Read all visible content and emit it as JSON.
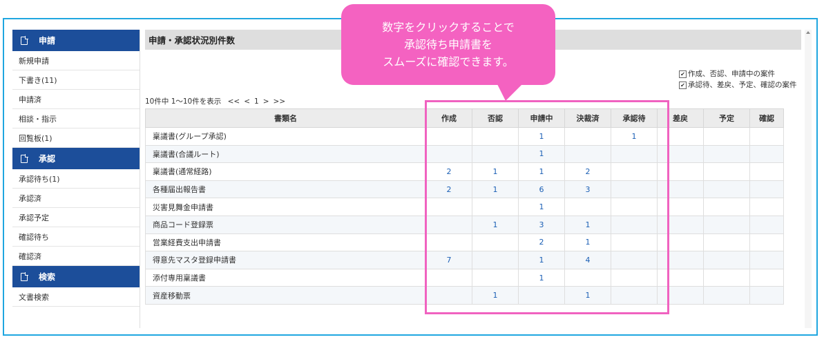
{
  "sidebar": {
    "sections": [
      {
        "title": "申請",
        "items": [
          "新規申請",
          "下書き(11)",
          "申請済",
          "相談・指示",
          "回覧板(1)"
        ]
      },
      {
        "title": "承認",
        "items": [
          "承認待ち(1)",
          "承認済",
          "承認予定",
          "確認待ち",
          "確認済"
        ]
      },
      {
        "title": "検索",
        "items": [
          "文書検索"
        ]
      }
    ]
  },
  "main": {
    "title": "申請・承認状況別件数",
    "filters": [
      "作成、否認、申請中の案件",
      "承認待、差戻、予定、確認の案件"
    ],
    "pager": {
      "summary": "10件中 1～10件を表示",
      "first": "<<",
      "prev": "<",
      "page": "1",
      "next": ">",
      "last": ">>"
    },
    "columns": [
      "書類名",
      "作成",
      "否認",
      "申請中",
      "決裁済",
      "承認待",
      "差戻",
      "予定",
      "確認"
    ],
    "rows": [
      [
        "稟議書(グループ承認)",
        "",
        "",
        "1",
        "",
        "1",
        "",
        "",
        ""
      ],
      [
        "稟議書(合議ルート)",
        "",
        "",
        "1",
        "",
        "",
        "",
        "",
        ""
      ],
      [
        "稟議書(通常経路)",
        "2",
        "1",
        "1",
        "2",
        "",
        "",
        "",
        ""
      ],
      [
        "各種届出報告書",
        "2",
        "1",
        "6",
        "3",
        "",
        "",
        "",
        ""
      ],
      [
        "災害見舞金申請書",
        "",
        "",
        "1",
        "",
        "",
        "",
        "",
        ""
      ],
      [
        "商品コード登録票",
        "",
        "1",
        "3",
        "1",
        "",
        "",
        "",
        ""
      ],
      [
        "営業経費支出申請書",
        "",
        "",
        "2",
        "1",
        "",
        "",
        "",
        ""
      ],
      [
        "得意先マスタ登録申請書",
        "7",
        "",
        "1",
        "4",
        "",
        "",
        "",
        ""
      ],
      [
        "添付専用稟議書",
        "",
        "",
        "1",
        "",
        "",
        "",
        "",
        ""
      ],
      [
        "資産移動票",
        "",
        "1",
        "",
        "1",
        "",
        "",
        "",
        ""
      ]
    ]
  },
  "callout": {
    "lines": [
      "数字をクリックすることで",
      "承認待ち申請書を",
      "スムーズに確認できます。"
    ]
  },
  "colors": {
    "accent": "#1c4e9a",
    "callout": "#f462c1",
    "frame": "#1fa6e0",
    "link": "#1b5fb5"
  },
  "icons": {
    "section": "document-icon",
    "checkbox": "checkbox-checked-icon"
  }
}
